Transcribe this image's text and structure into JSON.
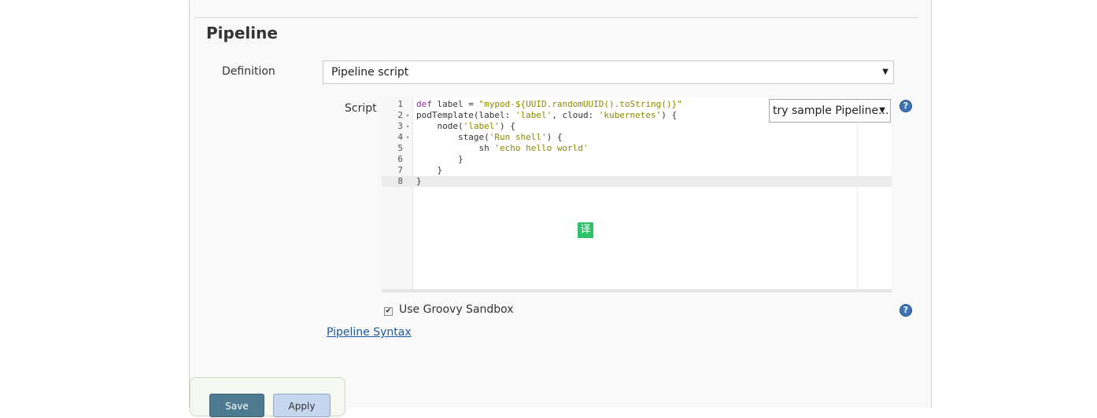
{
  "section": {
    "title": "Pipeline"
  },
  "definition": {
    "label": "Definition",
    "selected": "Pipeline script",
    "arrow": "▼"
  },
  "script": {
    "label": "Script",
    "sample_select": "try sample Pipeline...",
    "sample_arrow": "▼",
    "lines": [
      {
        "num": "1",
        "fold": ""
      },
      {
        "num": "2",
        "fold": "▾"
      },
      {
        "num": "3",
        "fold": "▾"
      },
      {
        "num": "4",
        "fold": "▾"
      },
      {
        "num": "5",
        "fold": ""
      },
      {
        "num": "6",
        "fold": ""
      },
      {
        "num": "7",
        "fold": ""
      },
      {
        "num": "8",
        "fold": ""
      }
    ],
    "code": {
      "l1_kw": "def",
      "l1_a": " label = ",
      "l1_str": "\"mypod-${UUID.randomUUID().toString()}\"",
      "l2_a": "podTemplate(label: ",
      "l2_str1": "'label'",
      "l2_b": ", cloud: ",
      "l2_str2": "'kubernetes'",
      "l2_c": ") {",
      "l3_a": "    node(",
      "l3_str": "'label'",
      "l3_b": ") {",
      "l4_a": "        stage(",
      "l4_str": "'Run shell'",
      "l4_b": ") {",
      "l5_a": "            sh ",
      "l5_str": "'echo hello world'",
      "l6": "        }",
      "l7": "    }",
      "l8": "}"
    }
  },
  "help_icon": {
    "glyph": "?"
  },
  "translate_badge": {
    "text": "译"
  },
  "sandbox": {
    "checked_glyph": "✔",
    "label": "Use Groovy Sandbox"
  },
  "links": {
    "pipeline_syntax": "Pipeline Syntax"
  },
  "buttons": {
    "save": "Save",
    "apply": "Apply"
  }
}
